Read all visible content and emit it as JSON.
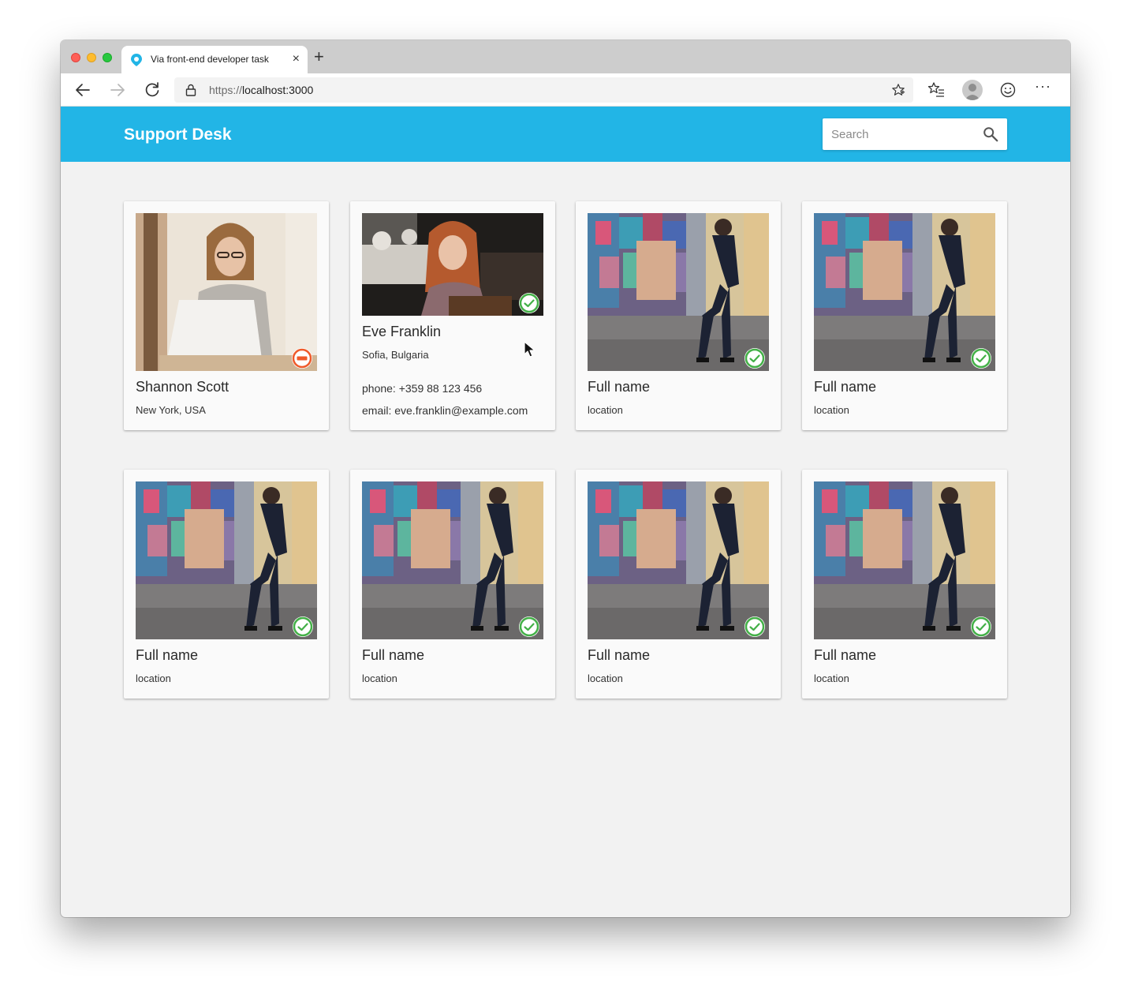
{
  "browser": {
    "tab_title": "Via front-end developer task",
    "tab_close": "×",
    "new_tab": "+",
    "url_scheme": "https://",
    "url_host": "localhost:3000",
    "more_menu": "···"
  },
  "header": {
    "title": "Support Desk",
    "search_placeholder": "Search",
    "search_value": "",
    "color": "#22b5e6"
  },
  "status_colors": {
    "available": "#43b047",
    "busy": "#ef5a2a"
  },
  "cards": [
    {
      "name": "Shannon Scott",
      "location": "New York, USA",
      "status": "busy",
      "photo": "woman-laptop"
    },
    {
      "name": "Eve Franklin",
      "location": "Sofia, Bulgaria",
      "status": "available",
      "photo": "woman-cafe",
      "phone": "phone: +359 88 123 456",
      "email": "email: eve.franklin@example.com"
    },
    {
      "name": "Full name",
      "location": "location",
      "status": "available",
      "photo": "man-street"
    },
    {
      "name": "Full name",
      "location": "location",
      "status": "available",
      "photo": "man-street"
    },
    {
      "name": "Full name",
      "location": "location",
      "status": "available",
      "photo": "man-street"
    },
    {
      "name": "Full name",
      "location": "location",
      "status": "available",
      "photo": "man-street"
    },
    {
      "name": "Full name",
      "location": "location",
      "status": "available",
      "photo": "man-street"
    },
    {
      "name": "Full name",
      "location": "location",
      "status": "available",
      "photo": "man-street"
    }
  ]
}
